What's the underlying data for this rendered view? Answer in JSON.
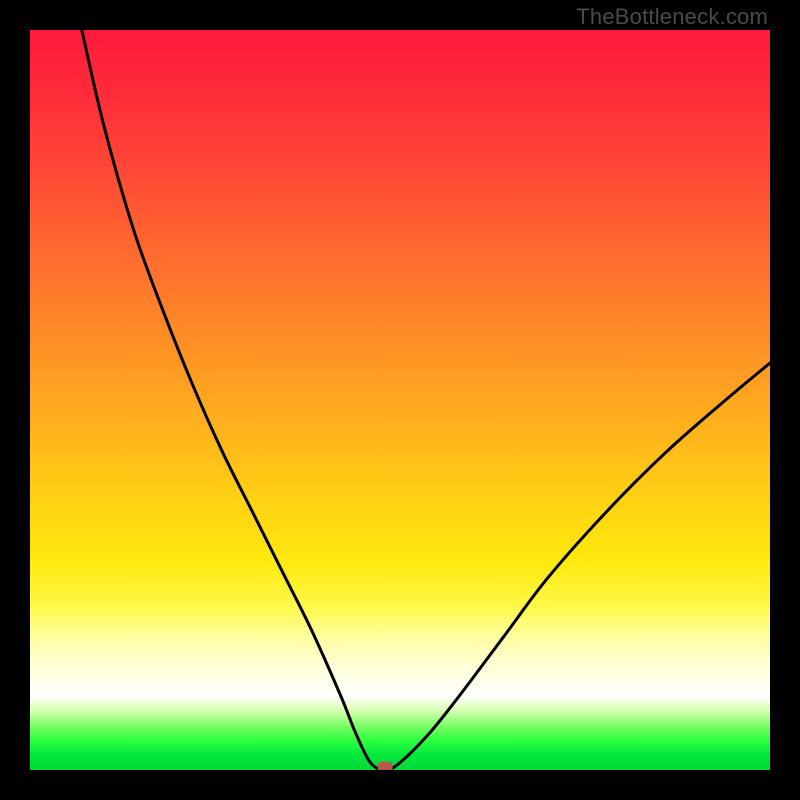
{
  "watermark": "TheBottleneck.com",
  "chart_data": {
    "type": "line",
    "title": "",
    "xlabel": "",
    "ylabel": "",
    "xlim": [
      0,
      100
    ],
    "ylim": [
      0,
      100
    ],
    "grid": false,
    "legend": false,
    "notes": "V-shaped bottleneck curve over a vertical red→orange→yellow→white→green gradient. Curve reaches 0 around x≈46–48 (marked with a small rounded rectangle), rises steeply to ~100 at x≈7 on the left and to ~55 at x=100 on the right. Right branch has visibly lower slope than the left. Values are estimated from pixel positions; no axis ticks are shown.",
    "series": [
      {
        "name": "bottleneck-curve",
        "x": [
          7,
          10,
          14,
          18,
          22,
          26,
          30,
          34,
          38,
          42,
          44,
          46,
          48,
          50,
          54,
          58,
          64,
          70,
          78,
          86,
          94,
          100
        ],
        "y": [
          100,
          87,
          73,
          62,
          52,
          43,
          35,
          27,
          19,
          10,
          5,
          1,
          0,
          1,
          5,
          10,
          18,
          26,
          35,
          43,
          50,
          55
        ]
      }
    ],
    "marker": {
      "x": 48,
      "y": 0,
      "shape": "rounded-rect",
      "color": "#b35a4a"
    },
    "background_gradient": {
      "direction": "vertical",
      "stops": [
        {
          "pos": 0.0,
          "color": "#ff1a3c"
        },
        {
          "pos": 0.3,
          "color": "#ff6a2e"
        },
        {
          "pos": 0.64,
          "color": "#ffd312"
        },
        {
          "pos": 0.82,
          "color": "#ffffa0"
        },
        {
          "pos": 0.9,
          "color": "#ffffff"
        },
        {
          "pos": 0.96,
          "color": "#2eff3f"
        },
        {
          "pos": 1.0,
          "color": "#00d838"
        }
      ]
    }
  }
}
